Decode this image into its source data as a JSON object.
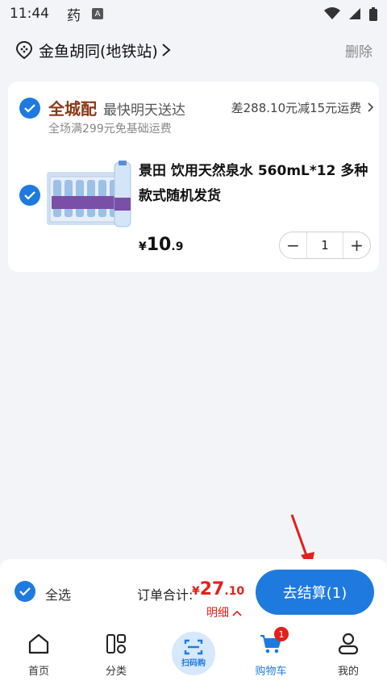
{
  "status_bar": {
    "time": "11:44",
    "app_glyph": "药",
    "a_badge": "A"
  },
  "header": {
    "address": "金鱼胡同(地铁站)",
    "delete_label": "删除"
  },
  "store_group": {
    "brand": "全城配",
    "delivery": "最快明天送达",
    "promo": "差288.10元减15元运费",
    "subtitle": "全场满299元免基础运费"
  },
  "item": {
    "name": "景田 饮用天然泉水 560mL*12 多种款式随机发货",
    "price_currency": "¥",
    "price_int": "10",
    "price_dec": ".9",
    "quantity": "1",
    "minus": "−",
    "plus": "+"
  },
  "checkout": {
    "select_all_label": "全选",
    "total_label": "订单合计:",
    "total_currency": "¥",
    "total_int": "27",
    "total_dec": ".10",
    "detail_label": "明细",
    "checkout_button": "去结算(1)"
  },
  "tabbar": {
    "items": [
      {
        "label": "首页",
        "icon": "home-icon"
      },
      {
        "label": "分类",
        "icon": "category-icon"
      },
      {
        "label": "扫码购",
        "icon": "scan-icon"
      },
      {
        "label": "购物车",
        "icon": "cart-icon",
        "badge": "1"
      },
      {
        "label": "我的",
        "icon": "profile-icon"
      }
    ]
  },
  "colors": {
    "accent": "#1f7ae0",
    "price": "#e3201a",
    "brand": "#8a3a18"
  }
}
